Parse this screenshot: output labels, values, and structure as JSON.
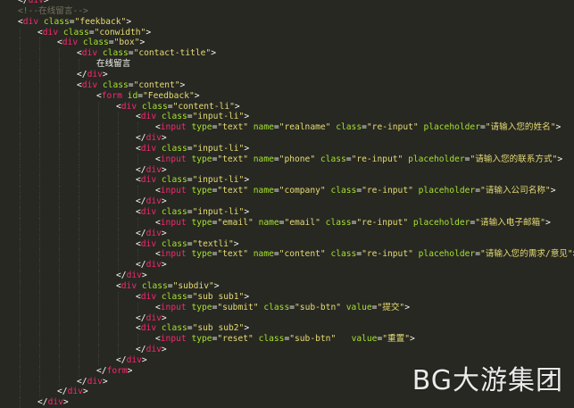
{
  "editor": {
    "lines": [
      {
        "indent": 1,
        "kind": "close",
        "tag": "div"
      },
      {
        "indent": 1,
        "kind": "comment",
        "text": "<!--在线留言-->"
      },
      {
        "indent": 1,
        "kind": "open",
        "tag": "div",
        "attrs": [
          [
            "class",
            "feekback"
          ]
        ]
      },
      {
        "indent": 2,
        "kind": "open",
        "tag": "div",
        "attrs": [
          [
            "class",
            "conwidth"
          ]
        ]
      },
      {
        "indent": 3,
        "kind": "open",
        "tag": "div",
        "attrs": [
          [
            "class",
            "box"
          ]
        ]
      },
      {
        "indent": 4,
        "kind": "open",
        "tag": "div",
        "attrs": [
          [
            "class",
            "contact-title"
          ]
        ]
      },
      {
        "indent": 5,
        "kind": "text",
        "text": "在线留言"
      },
      {
        "indent": 4,
        "kind": "close",
        "tag": "div"
      },
      {
        "indent": 4,
        "kind": "open",
        "tag": "div",
        "attrs": [
          [
            "class",
            "content"
          ]
        ]
      },
      {
        "indent": 5,
        "kind": "open",
        "tag": "form",
        "attrs": [
          [
            "id",
            "Feedback"
          ]
        ]
      },
      {
        "indent": 6,
        "kind": "open",
        "tag": "div",
        "attrs": [
          [
            "class",
            "content-li"
          ]
        ]
      },
      {
        "indent": 7,
        "kind": "open",
        "tag": "div",
        "attrs": [
          [
            "class",
            "input-li"
          ]
        ]
      },
      {
        "indent": 8,
        "kind": "open",
        "tag": "input",
        "attrs": [
          [
            "type",
            "text"
          ],
          [
            "name",
            "realname"
          ],
          [
            "class",
            "re-input"
          ],
          [
            "placeholder",
            "请输入您的姓名"
          ]
        ]
      },
      {
        "indent": 7,
        "kind": "close",
        "tag": "div"
      },
      {
        "indent": 7,
        "kind": "open",
        "tag": "div",
        "attrs": [
          [
            "class",
            "input-li"
          ]
        ]
      },
      {
        "indent": 8,
        "kind": "open",
        "tag": "input",
        "attrs": [
          [
            "type",
            "text"
          ],
          [
            "name",
            "phone"
          ],
          [
            "class",
            "re-input"
          ],
          [
            "placeholder",
            "请输入您的联系方式"
          ]
        ]
      },
      {
        "indent": 7,
        "kind": "close",
        "tag": "div"
      },
      {
        "indent": 7,
        "kind": "open",
        "tag": "div",
        "attrs": [
          [
            "class",
            "input-li"
          ]
        ]
      },
      {
        "indent": 8,
        "kind": "open",
        "tag": "input",
        "attrs": [
          [
            "type",
            "text"
          ],
          [
            "name",
            "company"
          ],
          [
            "class",
            "re-input"
          ],
          [
            "placeholder",
            "请输入公司名称"
          ]
        ]
      },
      {
        "indent": 7,
        "kind": "close",
        "tag": "div"
      },
      {
        "indent": 7,
        "kind": "open",
        "tag": "div",
        "attrs": [
          [
            "class",
            "input-li"
          ]
        ]
      },
      {
        "indent": 8,
        "kind": "open",
        "tag": "input",
        "attrs": [
          [
            "type",
            "email"
          ],
          [
            "name",
            "email"
          ],
          [
            "class",
            "re-input"
          ],
          [
            "placeholder",
            "请输入电子邮箱"
          ]
        ]
      },
      {
        "indent": 7,
        "kind": "close",
        "tag": "div"
      },
      {
        "indent": 7,
        "kind": "open",
        "tag": "div",
        "attrs": [
          [
            "class",
            "textli"
          ]
        ]
      },
      {
        "indent": 8,
        "kind": "open",
        "tag": "input",
        "attrs": [
          [
            "type",
            "text"
          ],
          [
            "name",
            "content"
          ],
          [
            "class",
            "re-input"
          ],
          [
            "placeholder",
            "请输入您的需求/意见"
          ]
        ]
      },
      {
        "indent": 7,
        "kind": "close",
        "tag": "div"
      },
      {
        "indent": 6,
        "kind": "close",
        "tag": "div"
      },
      {
        "indent": 6,
        "kind": "open",
        "tag": "div",
        "attrs": [
          [
            "class",
            "subdiv"
          ]
        ]
      },
      {
        "indent": 7,
        "kind": "open",
        "tag": "div",
        "attrs": [
          [
            "class",
            "sub sub1"
          ]
        ]
      },
      {
        "indent": 8,
        "kind": "open",
        "tag": "input",
        "attrs": [
          [
            "type",
            "submit"
          ],
          [
            "class",
            "sub-btn"
          ],
          [
            "value",
            "提交"
          ]
        ]
      },
      {
        "indent": 7,
        "kind": "close",
        "tag": "div"
      },
      {
        "indent": 7,
        "kind": "open",
        "tag": "div",
        "attrs": [
          [
            "class",
            "sub sub2"
          ]
        ]
      },
      {
        "indent": 8,
        "kind": "open",
        "tag": "input",
        "attrs": [
          [
            "type",
            "reset"
          ],
          [
            "class",
            "sub-btn"
          ],
          [
            "value",
            "重置"
          ]
        ],
        "gap": "  "
      },
      {
        "indent": 7,
        "kind": "close",
        "tag": "div"
      },
      {
        "indent": 6,
        "kind": "close",
        "tag": "div"
      },
      {
        "indent": 5,
        "kind": "close",
        "tag": "form"
      },
      {
        "indent": 4,
        "kind": "close",
        "tag": "div"
      },
      {
        "indent": 3,
        "kind": "close",
        "tag": "div"
      },
      {
        "indent": 2,
        "kind": "close",
        "tag": "div"
      }
    ]
  },
  "watermark": "BG大游集团",
  "colors": {
    "background": "#272822",
    "tag": "#F92672",
    "attribute": "#A6E22E",
    "string": "#E6DB74",
    "text": "#F8F8F2",
    "comment": "#75715E"
  }
}
